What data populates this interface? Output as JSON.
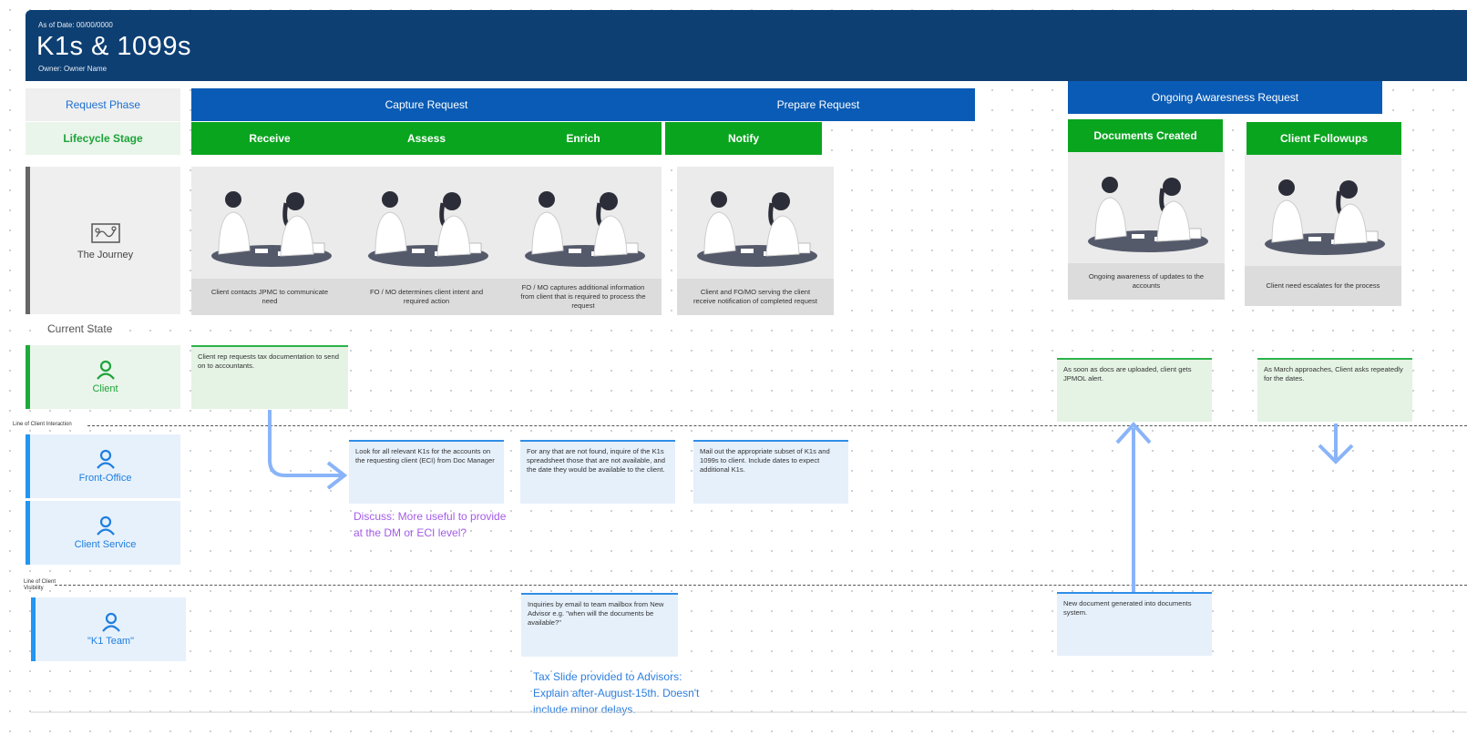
{
  "header": {
    "as_of_date": "As of Date: 00/00/0000",
    "title": "K1s & 1099s",
    "owner": "Owner: Owner Name"
  },
  "row_labels": {
    "request_phase": "Request Phase",
    "lifecycle_stage": "Lifecycle Stage",
    "journey": "The Journey",
    "current_state": "Current State"
  },
  "phases": [
    "Capture Request",
    "Prepare Request",
    "Ongoing Awaresness Request"
  ],
  "stages": [
    "Receive",
    "Assess",
    "Enrich",
    "Notify",
    "Documents Created",
    "Client Followups"
  ],
  "journey_captions": [
    "Client contacts JPMC to communicate need",
    "FO / MO determines client intent and required action",
    "FO / MO captures additional information from client that is required to process the request",
    "Client and FO/MO serving the client receive notification of completed request",
    "Ongoing awareness of updates to the accounts",
    "Client need escalates for the process"
  ],
  "lanes": {
    "client": "Client",
    "front_office": "Front-Office",
    "client_service": "Client Service",
    "k1_team": "\"K1 Team\""
  },
  "lines": {
    "interaction": "Line of Client Interaction",
    "visibility_1": "Line of   Client",
    "visibility_2": "Visibility"
  },
  "notes": {
    "client_receive": "Client rep requests tax documentation to send on to accountants.",
    "client_docs": "As soon as docs are uploaded, client gets JPMOL alert.",
    "client_followups": "As March approaches, Client asks repeatedly for the dates.",
    "fo_assess": "Look for all relevant K1s for the accounts on the requesting client (ECI) from Doc Manager",
    "fo_enrich": "For any that are not found, inquire of the K1s spreadsheet those that are not available, and the date they would be available to the client.",
    "fo_notify": "Mail out the appropriate subset of K1s and 1099s to client. Include dates to expect additional K1s.",
    "k1_enrich": "Inquiries by email to team mailbox from New Advisor e.g. \"when will the documents be available?\"",
    "k1_docs": "New document generated into documents system."
  },
  "comments": {
    "discuss_1": "Discuss: More useful to provide",
    "discuss_2": "at the  DM or ECI level?",
    "tax_1": "Tax Slide provided to Advisors:",
    "tax_2": "Explain after-August-15th. Doesn't",
    "tax_3": "include minor delays."
  },
  "colors": {
    "header": "#0d3f73",
    "phase": "#0a5bb5",
    "stage": "#0aa51f",
    "blue_lane": "#2196f3",
    "green_lane": "#1eaa3a",
    "discuss_comment": "#a35ce8",
    "tax_comment": "#2d7fe0"
  }
}
